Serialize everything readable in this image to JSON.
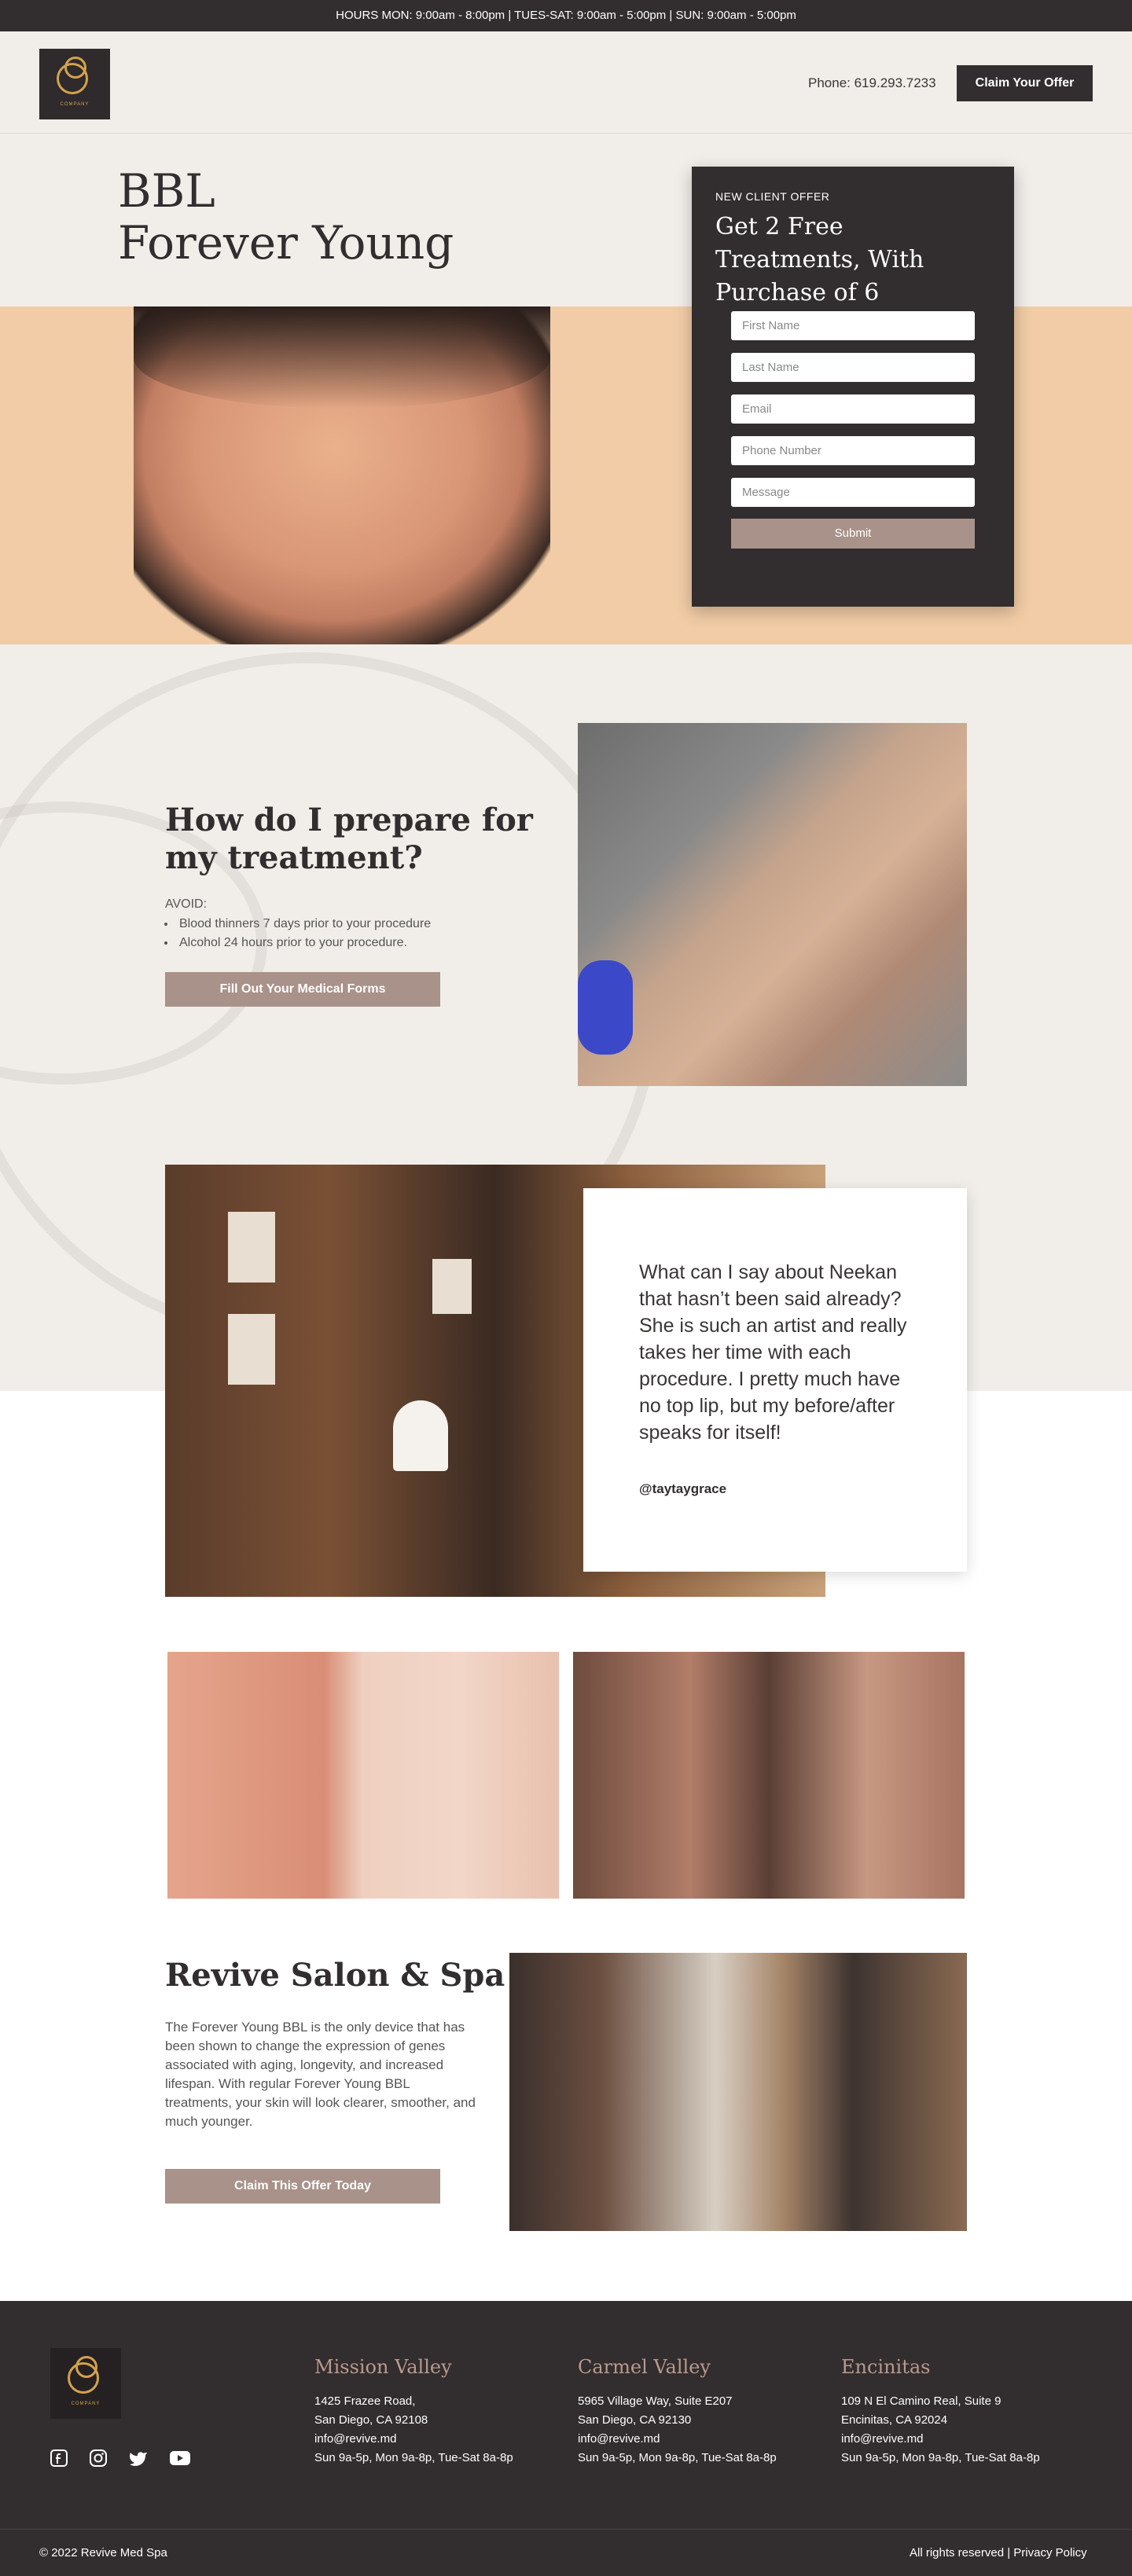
{
  "topbar": {
    "hours": "HOURS MON: 9:00am - 8:00pm | TUES-SAT: 9:00am - 5:00pm | SUN: 9:00am - 5:00pm"
  },
  "header": {
    "logo_text": "COMPANY",
    "phone": "Phone: 619.293.7233",
    "cta_label": "Claim Your Offer"
  },
  "hero": {
    "title_line1": "BBL",
    "title_line2": "Forever Young"
  },
  "offer_form": {
    "kicker": "NEW CLIENT OFFER",
    "title": "Get 2 Free Treatments, With Purchase of 6",
    "fields": [
      {
        "placeholder": "First Name"
      },
      {
        "placeholder": "Last Name"
      },
      {
        "placeholder": "Email"
      },
      {
        "placeholder": "Phone Number"
      },
      {
        "placeholder": "Message"
      }
    ],
    "submit_label": "Submit"
  },
  "prepare": {
    "title": "How do I prepare for my treatment?",
    "avoid_label": "AVOID:",
    "items": [
      "Blood thinners 7 days prior to your procedure",
      "Alcohol 24 hours prior to your procedure."
    ],
    "button_label": "Fill Out Your Medical Forms"
  },
  "testimonial": {
    "quote": "What can I say about Neekan that hasn’t been said already? She is such an artist and really takes her time with each procedure. I pretty much have no top lip, but my before/after speaks for itself!",
    "author": "@taytaygrace"
  },
  "revive": {
    "title": "Revive Salon & Spa",
    "text": "The Forever Young BBL is the only device that has been shown to change the expression of genes associated with aging, longevity, and increased lifespan. With regular Forever Young BBL treatments, your skin will look clearer, smoother, and much younger.",
    "button_label": "Claim This Offer Today"
  },
  "footer": {
    "logo_text": "COMPANY",
    "social_icons": [
      "facebook-icon",
      "instagram-icon",
      "twitter-icon",
      "youtube-icon"
    ],
    "locations": [
      {
        "name": "Mission Valley",
        "address1": "1425 Frazee Road,",
        "address2": "San Diego, CA 92108",
        "email": "info@revive.md",
        "hours": "Sun 9a-5p, Mon 9a-8p, Tue-Sat 8a-8p"
      },
      {
        "name": "Carmel Valley",
        "address1": "5965 Village Way, Suite E207",
        "address2": "San Diego, CA 92130",
        "email": "info@revive.md",
        "hours": "Sun 9a-5p, Mon 9a-8p, Tue-Sat 8a-8p"
      },
      {
        "name": "Encinitas",
        "address1": "109 N El Camino Real, Suite 9",
        "address2": "Encinitas, CA 92024",
        "email": "info@revive.md",
        "hours": "Sun 9a-5p, Mon 9a-8p, Tue-Sat 8a-8p"
      }
    ],
    "copyright": "© 2022 Revive Med Spa",
    "rights": "All rights reserved | Privacy Policy"
  },
  "colors": {
    "dark": "#322d2e",
    "cream": "#f1eeea",
    "peach": "#f1cca6",
    "button_taupe": "#a89289",
    "gold": "#d4a24e"
  }
}
